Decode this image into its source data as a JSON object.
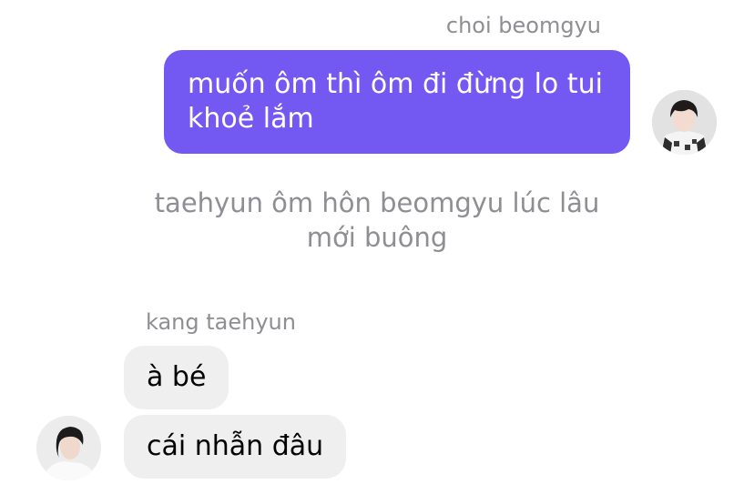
{
  "messages": {
    "outgoing": {
      "sender": "choi beomgyu",
      "text": "muốn ôm thì ôm đi đừng lo tui khoẻ lắm"
    },
    "system": {
      "text": "taehyun ôm hôn beomgyu lúc lâu mới buông"
    },
    "incoming": {
      "sender": "kang taehyun",
      "bubbles": [
        {
          "text": "à bé"
        },
        {
          "text": "cái nhẫn đâu"
        }
      ]
    }
  },
  "colors": {
    "outgoing_bubble": "#7359f2",
    "incoming_bubble": "#efefef",
    "secondary_text": "#8e8e93"
  },
  "icons": {
    "outgoing_avatar": "avatar",
    "incoming_avatar": "avatar"
  }
}
